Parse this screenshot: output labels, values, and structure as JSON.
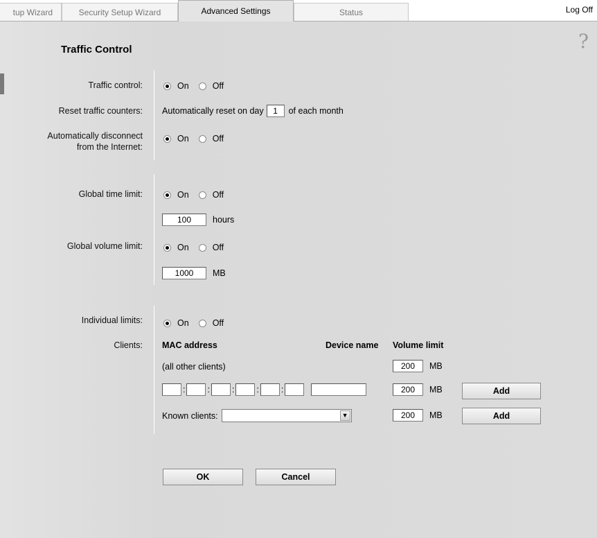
{
  "tabs": [
    {
      "label": "tup Wizard"
    },
    {
      "label": "Security Setup Wizard"
    },
    {
      "label": "Advanced Settings"
    },
    {
      "label": "Status"
    }
  ],
  "logoff": "Log Off",
  "page": {
    "title": "Traffic Control",
    "help": "?"
  },
  "labels": {
    "traffic_control": "Traffic control:",
    "reset_counters": "Reset traffic counters:",
    "auto_disconnect_1": "Automatically disconnect",
    "auto_disconnect_2": "from the Internet:",
    "global_time": "Global time limit:",
    "global_volume": "Global volume limit:",
    "individual": "Individual limits:",
    "clients": "Clients:"
  },
  "radio": {
    "on": "On",
    "off": "Off"
  },
  "reset": {
    "prefix": "Automatically reset on day",
    "day": "1",
    "suffix": "of each month"
  },
  "time_limit": {
    "value": "100",
    "unit": "hours"
  },
  "volume_limit": {
    "value": "1000",
    "unit": "MB"
  },
  "clients_table": {
    "col_mac": "MAC address",
    "col_device": "Device name",
    "col_volume": "Volume limit",
    "all_other": "(all other clients)",
    "all_other_value": "200",
    "mac_sep": ":",
    "new_value": "200",
    "known_label": "Known clients:",
    "known_selected": "",
    "known_value": "200",
    "unit": "MB",
    "add": "Add"
  },
  "buttons": {
    "ok": "OK",
    "cancel": "Cancel"
  }
}
